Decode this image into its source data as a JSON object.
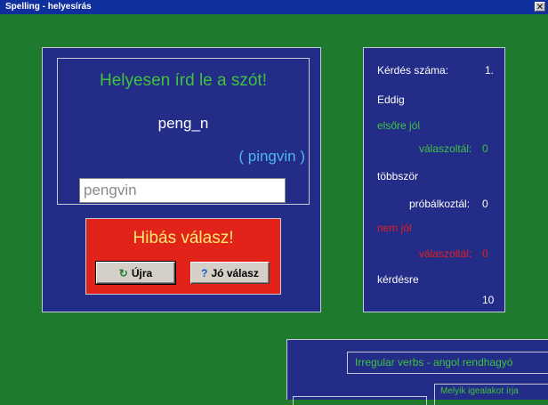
{
  "window": {
    "title": "Spelling - helyesírás",
    "close_label": "✕"
  },
  "question": {
    "heading": "Helyesen írd le a szót!",
    "pattern": "peng_n",
    "hint": "( pingvin )",
    "input_value": "pengvin"
  },
  "feedback": {
    "message": "Hibás válasz!",
    "retry_label": "Újra",
    "retry_icon": "↻",
    "answer_label": "Jó válasz",
    "answer_icon": "?"
  },
  "stats": {
    "question_label": "Kérdés száma:",
    "question_number": "1.",
    "so_far": "Eddig",
    "first_try_1": "elsőre jól",
    "first_try_2": "válaszoltál:",
    "first_try_count": "0",
    "multi_1": "többször",
    "multi_2": "próbálkoztál:",
    "multi_count": "0",
    "wrong_1": "nem jól",
    "wrong_2": "válaszoltál:",
    "wrong_count": "0",
    "of_label": "kérdésre",
    "total": "10"
  },
  "verbs_window": {
    "title": "Irregular verbs - angol rendhagyó",
    "prompt": "Melyik igealakot írja"
  },
  "colors": {
    "background": "#1e7a2c",
    "panel": "#232c86",
    "accent_green": "#3fc33f",
    "accent_red": "#e2231a",
    "hint_blue": "#4fb7ea"
  }
}
